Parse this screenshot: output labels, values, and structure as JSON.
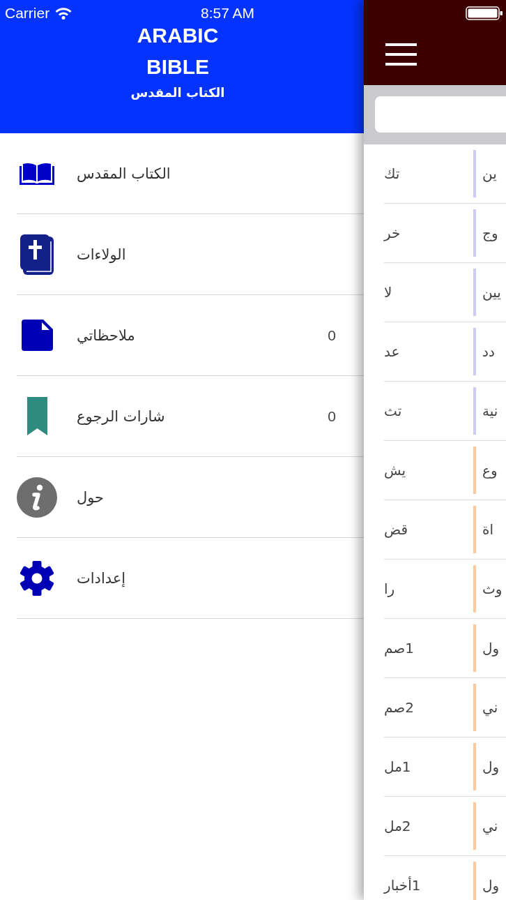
{
  "status_bar": {
    "carrier": "Carrier",
    "time": "8:57 AM"
  },
  "drawer": {
    "title": "ARABIC BIBLE",
    "subtitle": "الكتاب المقدس",
    "items": [
      {
        "label": "الكتاب المقدس"
      },
      {
        "label": "الولاءات"
      },
      {
        "label": "ملاحظاتي",
        "count": "0"
      },
      {
        "label": "شارات الرجوع",
        "count": "0"
      },
      {
        "label": "حول"
      },
      {
        "label": "إعدادات"
      }
    ]
  },
  "main": {
    "books": [
      {
        "abbreviation": "تك",
        "name": "ين",
        "color": "#cbcbf3"
      },
      {
        "abbreviation": "خر",
        "name": "وج",
        "color": "#cbcbf3"
      },
      {
        "abbreviation": "لا",
        "name": "يين",
        "color": "#cbcbf3"
      },
      {
        "abbreviation": "عد",
        "name": "دد",
        "color": "#cbcbf3"
      },
      {
        "abbreviation": "تث",
        "name": "نية",
        "color": "#cbcbf3"
      },
      {
        "abbreviation": "يش",
        "name": "وع",
        "color": "#f8ca9e"
      },
      {
        "abbreviation": "قض",
        "name": "اة",
        "color": "#f8ca9e"
      },
      {
        "abbreviation": "را",
        "name": "وث",
        "color": "#f8ca9e"
      },
      {
        "abbreviation": "1صم",
        "name": "ول",
        "color": "#f8ca9e"
      },
      {
        "abbreviation": "2صم",
        "name": "ني",
        "color": "#f8ca9e"
      },
      {
        "abbreviation": "1مل",
        "name": "ول",
        "color": "#f8ca9e"
      },
      {
        "abbreviation": "2مل",
        "name": "ني",
        "color": "#f8ca9e"
      },
      {
        "abbreviation": "1أخبار",
        "name": "ول",
        "color": "#f8ca9e"
      }
    ]
  }
}
